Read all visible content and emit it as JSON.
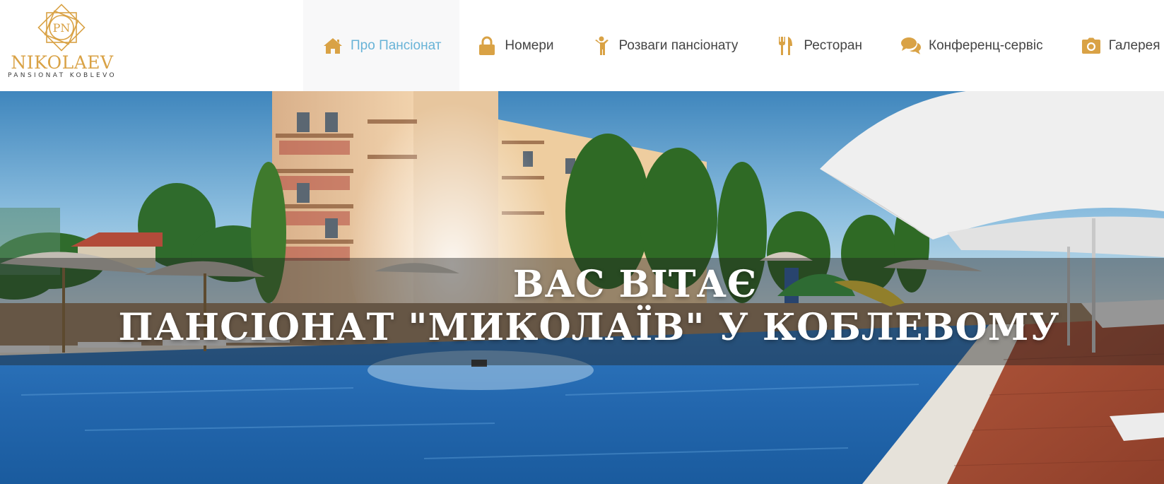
{
  "brand": {
    "monogram": "PN",
    "name": "NIKOLAEV",
    "tagline": "PANSIONAT KOBLEVO",
    "color": "#d9a245"
  },
  "nav": {
    "items": [
      {
        "label": "Про Пансіонат",
        "icon": "home-icon",
        "active": true
      },
      {
        "label": "Номери",
        "icon": "lock-icon",
        "active": false
      },
      {
        "label": "Розваги пансіонату",
        "icon": "child-icon",
        "active": false
      },
      {
        "label": "Ресторан",
        "icon": "cutlery-icon",
        "active": false
      },
      {
        "label": "Конференц-сервіс",
        "icon": "comments-icon",
        "active": false
      },
      {
        "label": "Галерея",
        "icon": "camera-icon",
        "active": false
      }
    ],
    "active_color": "#68b3d7",
    "icon_color": "#d9a245"
  },
  "hero": {
    "line1": "ВАС ВІТАЄ",
    "line2": "ПАНСІОНАТ \"МИКОЛАЇВ\" У КОБЛЕВОМУ"
  }
}
